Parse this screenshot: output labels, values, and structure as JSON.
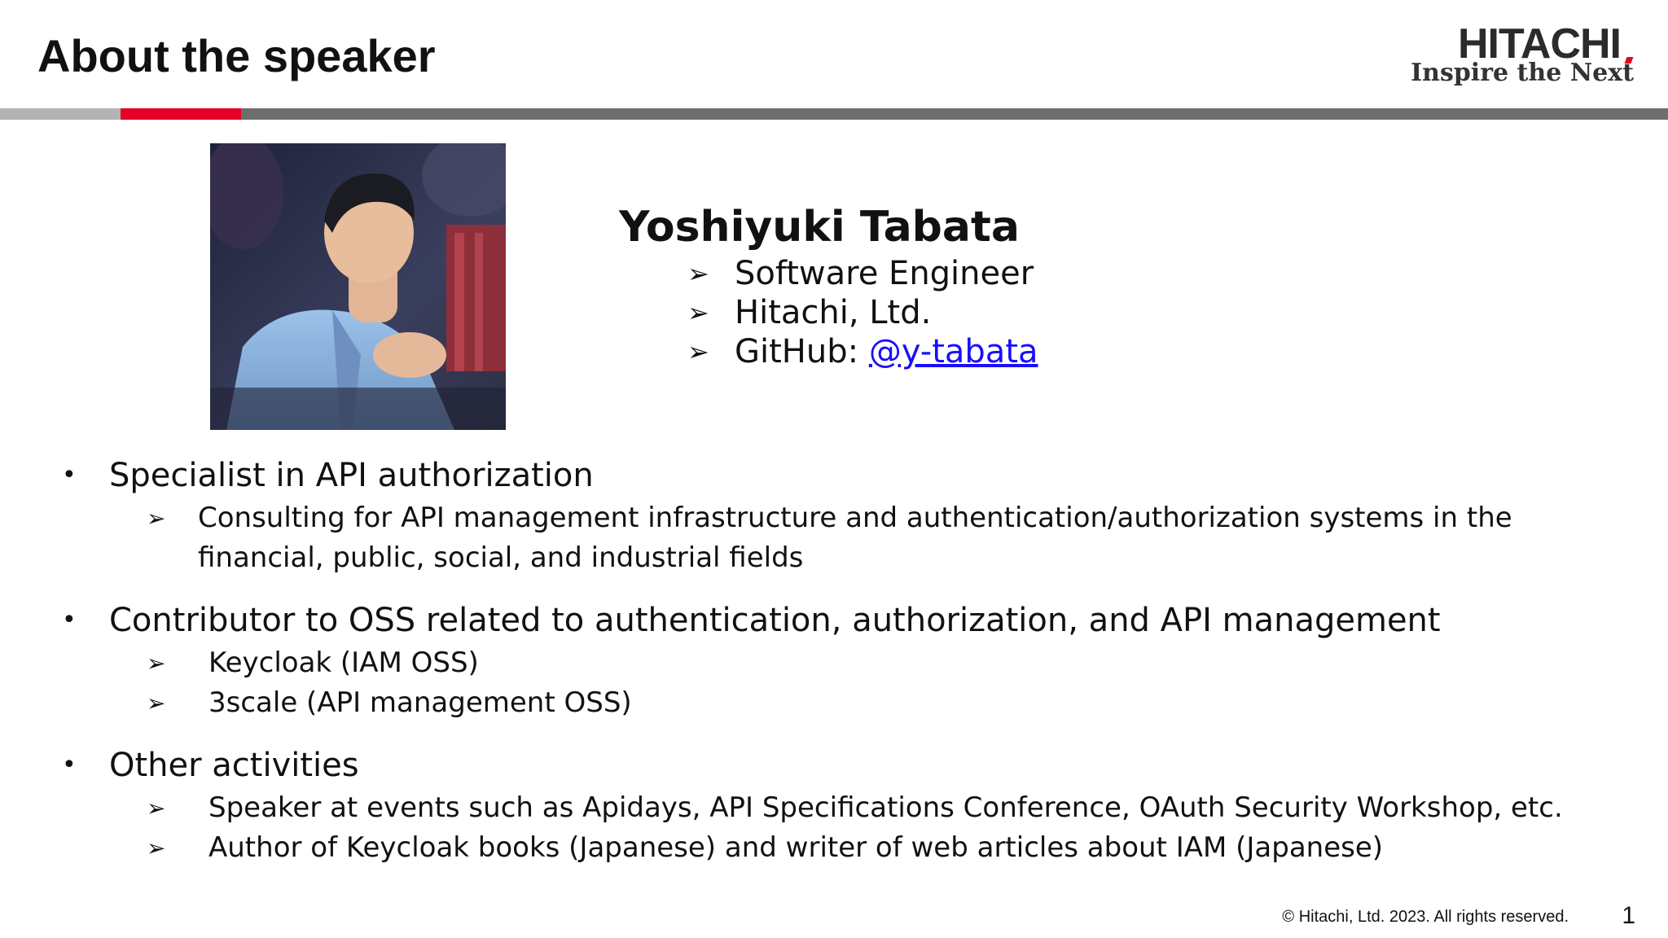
{
  "slide": {
    "title": "About the speaker",
    "page_number": "1",
    "copyright": "© Hitachi, Ltd. 2023. All rights reserved."
  },
  "logo": {
    "word": "HITACHI",
    "tagline": "Inspire the Next",
    "accent_color": "#e60027"
  },
  "header_bar": {
    "colors": {
      "left": "#b3b3b3",
      "accent": "#e60027",
      "rest": "#6e6e6e"
    }
  },
  "profile": {
    "name": "Yoshiyuki Tabata",
    "items": [
      {
        "text": "Software Engineer"
      },
      {
        "text": "Hitachi, Ltd."
      },
      {
        "prefix": "GitHub: ",
        "link": "@y-tabata",
        "link_color": "#1a0dff"
      }
    ]
  },
  "sections": [
    {
      "heading": "Specialist in API authorization",
      "items": [
        "Consulting for API management infrastructure and authentication/authorization systems in the financial, public, social, and industrial fields"
      ]
    },
    {
      "heading": "Contributor to OSS related to authentication, authorization, and API management",
      "items": [
        "Keycloak (IAM OSS)",
        "3scale (API management OSS)"
      ]
    },
    {
      "heading": "Other activities",
      "items": [
        "Speaker at events such as Apidays, API Specifications Conference, OAuth Security Workshop, etc.",
        "Author of Keycloak books (Japanese) and writer of web articles about IAM (Japanese)"
      ]
    }
  ],
  "icons": {
    "bullet": "•",
    "arrow": "➢"
  }
}
